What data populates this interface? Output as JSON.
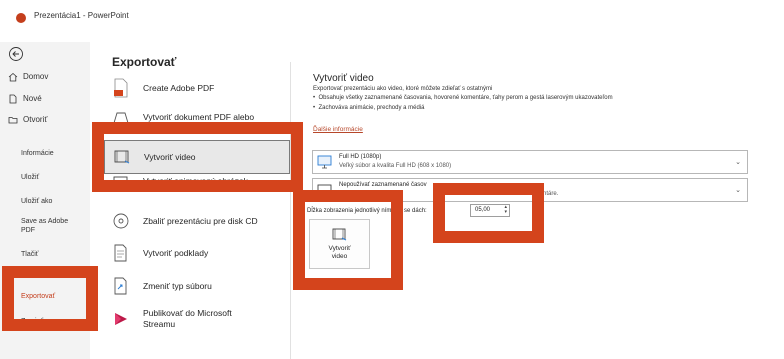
{
  "window": {
    "title": "Prezentácia1 - PowerPoint"
  },
  "sidebar": {
    "top_items": [
      {
        "label": "Domov",
        "icon": "home-icon"
      },
      {
        "label": "Nové",
        "icon": "new-document-icon"
      },
      {
        "label": "Otvoriť",
        "icon": "folder-icon"
      }
    ],
    "sub_items": [
      {
        "label": "Informácie"
      },
      {
        "label": "Uložiť"
      },
      {
        "label": "Uložiť ako"
      },
      {
        "label": "Save as Adobe PDF"
      },
      {
        "label": "Tlačiť"
      },
      {
        "label": "Exportovať",
        "active": true
      },
      {
        "label": "Zavrieť"
      }
    ]
  },
  "center": {
    "heading": "Exportovať",
    "options": [
      {
        "label": "Create Adobe PDF",
        "icon": "adobe-pdf-icon"
      },
      {
        "label": "Vytvoriť dokument PDF alebo",
        "icon": "pdf-xps-icon"
      },
      {
        "label": "Vytvoriť video",
        "icon": "video-icon",
        "selected": true
      },
      {
        "label": "Vytvoriť animovaný obrázok",
        "icon": "gif-icon"
      },
      {
        "label": "Zbaliť prezentáciu pre disk CD",
        "icon": "cd-icon"
      },
      {
        "label": "Vytvoriť podklady",
        "icon": "handouts-icon"
      },
      {
        "label": "Zmeniť typ súboru",
        "icon": "file-type-icon"
      },
      {
        "label": "Publikovať do Microsoft Streamu",
        "icon": "stream-icon"
      }
    ]
  },
  "right": {
    "title": "Vytvoriť video",
    "description": "Exportovať prezentáciu ako video, ktoré môžete zdieľať s ostatnými",
    "bullets": [
      "Obsahuje všetky zaznamenané časovania, hovorené komentáre, ťahy perom a gestá laserovým ukazovateľom",
      "Zachováva animácie, prechody a médiá"
    ],
    "link": "Ďalšie informácie",
    "quality": {
      "main": "Full HD (1080p)",
      "sub": "Veľký súbor a kvalita Full HD (608 x 1080)"
    },
    "timings": {
      "main": "Nepoužívať zaznamenané časov",
      "sub": "dne časov ani hovorené komentáre."
    },
    "duration_label": "Dĺžka zobrazenia jednotlivý nímok v se dách:",
    "duration_value": "05,00",
    "create_button": "Vytvoriť video"
  },
  "colors": {
    "accent": "#c43e1c",
    "highlight": "#d4441c"
  }
}
